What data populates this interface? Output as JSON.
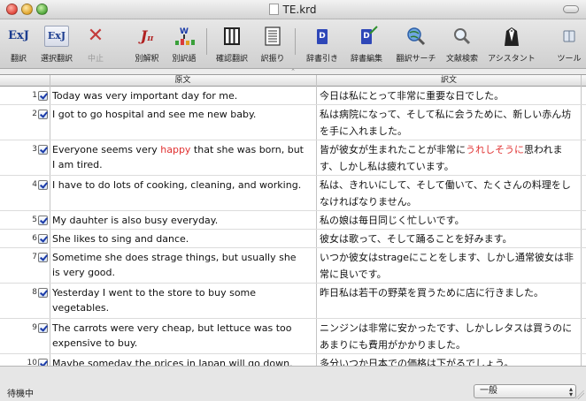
{
  "window": {
    "title": "TE.krd"
  },
  "toolbar": {
    "buttons": [
      {
        "key": "translate",
        "label": "翻訳",
        "icon": "exj-translate-icon",
        "glyph": "ExJ"
      },
      {
        "key": "select_translate",
        "label": "選択翻訳",
        "icon": "exj-select-translate-icon",
        "glyph": "ExJ"
      },
      {
        "key": "stop",
        "label": "中止",
        "icon": "stop-x-icon",
        "glyph": "✕"
      },
      {
        "key": "alt_translation",
        "label": "別解釈",
        "icon": "alt-interpretation-icon",
        "glyph": "J"
      },
      {
        "key": "alt_word",
        "label": "別訳語",
        "icon": "alt-word-icon",
        "glyph": "W"
      },
      {
        "key": "confirm_translation",
        "label": "確認翻訳",
        "icon": "confirm-columns-icon"
      },
      {
        "key": "split_view",
        "label": "訳振り",
        "icon": "split-lines-icon"
      },
      {
        "key": "dictionary_lookup",
        "label": "辞書引き",
        "icon": "dictionary-book-icon",
        "glyph": "D"
      },
      {
        "key": "dictionary_edit",
        "label": "辞書編集",
        "icon": "dictionary-edit-icon",
        "glyph": "D"
      },
      {
        "key": "translation_search",
        "label": "翻訳サーチ",
        "icon": "globe-search-icon"
      },
      {
        "key": "text_search",
        "label": "文献検索",
        "icon": "magnifier-icon"
      },
      {
        "key": "assistant",
        "label": "アシスタント",
        "icon": "assistant-tuxedo-icon"
      },
      {
        "key": "tools",
        "label": "ツール",
        "icon": "tools-panel-icon"
      }
    ]
  },
  "table": {
    "headers": {
      "source": "原文",
      "target": "訳文"
    },
    "rows": [
      {
        "num": "1",
        "checked": true,
        "src": "Today was very important day for me.",
        "tgt": "今日は私にとって非常に重要な日でした。"
      },
      {
        "num": "2",
        "checked": true,
        "src": "I got to go hospital and see me new baby.",
        "tgt": "私は病院になって、そして私に会うために、新しい赤ん坊を手に入れました。"
      },
      {
        "num": "3",
        "checked": true,
        "src_pre": "Everyone seems very ",
        "src_hl": "happy",
        "src_post": " that she was born, but I am tired.",
        "tgt_pre": "皆が彼女が生まれたことが非常に",
        "tgt_hl": "うれしそうに",
        "tgt_post": "思われます、しかし私は疲れています。"
      },
      {
        "num": "4",
        "checked": true,
        "src": "I have to do lots of cooking, cleaning, and working.",
        "tgt": "私は、きれいにして、そして働いて、たくさんの料理をしなければなりません。"
      },
      {
        "num": "5",
        "checked": true,
        "src": "My dauhter is also busy everyday.",
        "tgt": "私の娘は毎日同じく忙しいです。"
      },
      {
        "num": "6",
        "checked": true,
        "src": "She likes to sing and dance.",
        "tgt": "彼女は歌って、そして踊ることを好みます。"
      },
      {
        "num": "7",
        "checked": true,
        "src": "Sometime she does strage things, but usually she is very good.",
        "tgt": "いつか彼女はstrageにことをします、しかし通常彼女は非常に良いです。"
      },
      {
        "num": "8",
        "checked": true,
        "src": "Yesterday I went to the store to buy some vegetables.",
        "tgt": "昨日私は若干の野菜を買うために店に行きました。"
      },
      {
        "num": "9",
        "checked": true,
        "src": "The carrots were very cheap, but lettuce was too expensive to buy.",
        "tgt": "ニンジンは非常に安かったです、しかしレタスは買うのにあまりにも費用がかかりました。"
      },
      {
        "num": "10",
        "checked": true,
        "src": "Maybe someday the prices in Japan will go down.",
        "tgt": "多分いつか日本での価格は下がるでしょう。"
      }
    ]
  },
  "status": {
    "text": "待機中",
    "mode_select": "一般"
  },
  "colors": {
    "highlight": "#e03030",
    "checkbox_mark": "#1a3aa8"
  }
}
